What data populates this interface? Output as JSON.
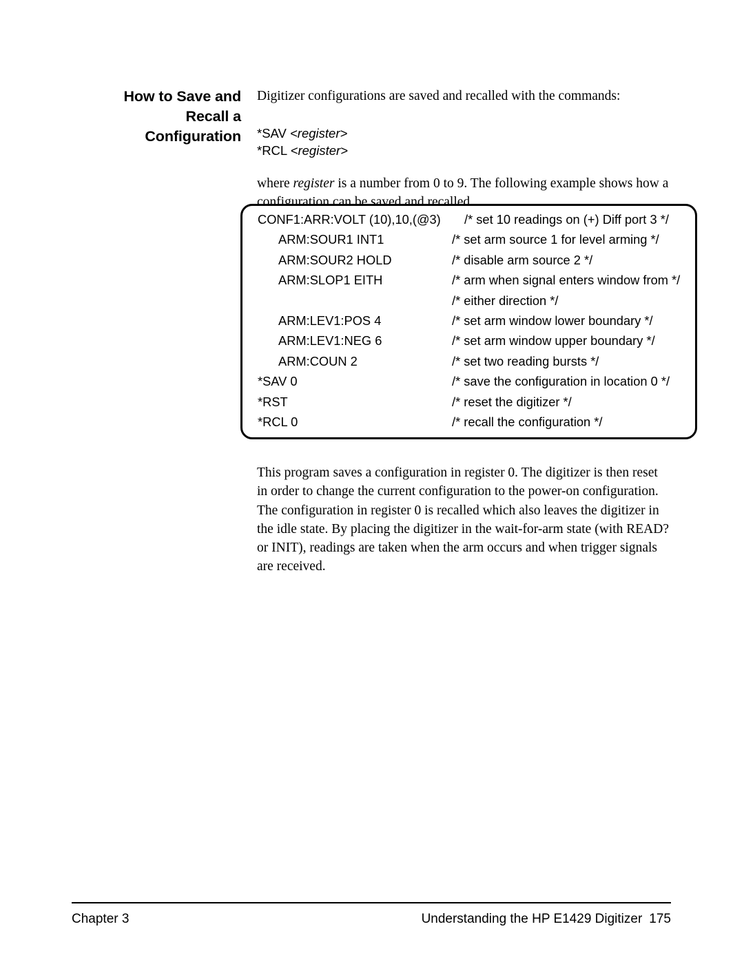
{
  "section": {
    "heading_lines": [
      "How to Save and",
      "Recall a",
      "Configuration"
    ]
  },
  "intro": {
    "lead": "Digitizer configurations are saved and recalled with the commands:",
    "commands": [
      {
        "name": "*SAV",
        "arg": "<register>"
      },
      {
        "name": "*RCL",
        "arg": "<register>"
      }
    ],
    "where_before": "where ",
    "where_italic": "register",
    "where_after": " is a number from 0 to 9. The following example shows how a configuration can be saved and recalled."
  },
  "code_example": {
    "lines": [
      {
        "command": "CONF1:ARR:VOLT (10),10,(@3)",
        "indent": 0,
        "comment": "/* set 10 readings on (+) Diff port 3 */",
        "comment_far": true
      },
      {
        "command": "ARM:SOUR1 INT1",
        "indent": 1,
        "comment": "/* set arm source 1 for level arming */",
        "comment_far": false
      },
      {
        "command": "ARM:SOUR2 HOLD",
        "indent": 1,
        "comment": "/* disable arm source 2 */",
        "comment_far": false
      },
      {
        "command": "ARM:SLOP1 EITH",
        "indent": 1,
        "comment": "/* arm when signal enters window from */",
        "comment_far": false
      },
      {
        "command": "",
        "indent": 1,
        "comment": "/* either direction */",
        "comment_far": false
      },
      {
        "command": "ARM:LEV1:POS 4",
        "indent": 1,
        "comment": "/* set arm window lower boundary */",
        "comment_far": false
      },
      {
        "command": "ARM:LEV1:NEG 6",
        "indent": 1,
        "comment": "/* set arm window upper boundary */",
        "comment_far": false
      },
      {
        "command": "ARM:COUN 2",
        "indent": 1,
        "comment": "/* set two reading bursts */",
        "comment_far": false
      },
      {
        "command": "*SAV 0",
        "indent": 0,
        "comment": "/* save the configuration in location 0 */",
        "comment_far": false
      },
      {
        "command": "*RST",
        "indent": 0,
        "comment": "/* reset  the digitizer */",
        "comment_far": false
      },
      {
        "command": "*RCL 0",
        "indent": 0,
        "comment": "/* recall the configuration */",
        "comment_far": false
      }
    ]
  },
  "body": {
    "paragraph": "This program saves a configuration in register 0. The digitizer is then reset in order to change the current configuration to the power-on configuration. The configuration in register 0 is recalled which also leaves the digitizer in the idle state. By placing the digitizer in the wait-for-arm state (with READ? or INIT), readings are taken when the arm occurs and when trigger signals are received."
  },
  "footer": {
    "left": "Chapter 3",
    "title": "Understanding the HP E1429 Digitizer",
    "page_number": "175"
  }
}
